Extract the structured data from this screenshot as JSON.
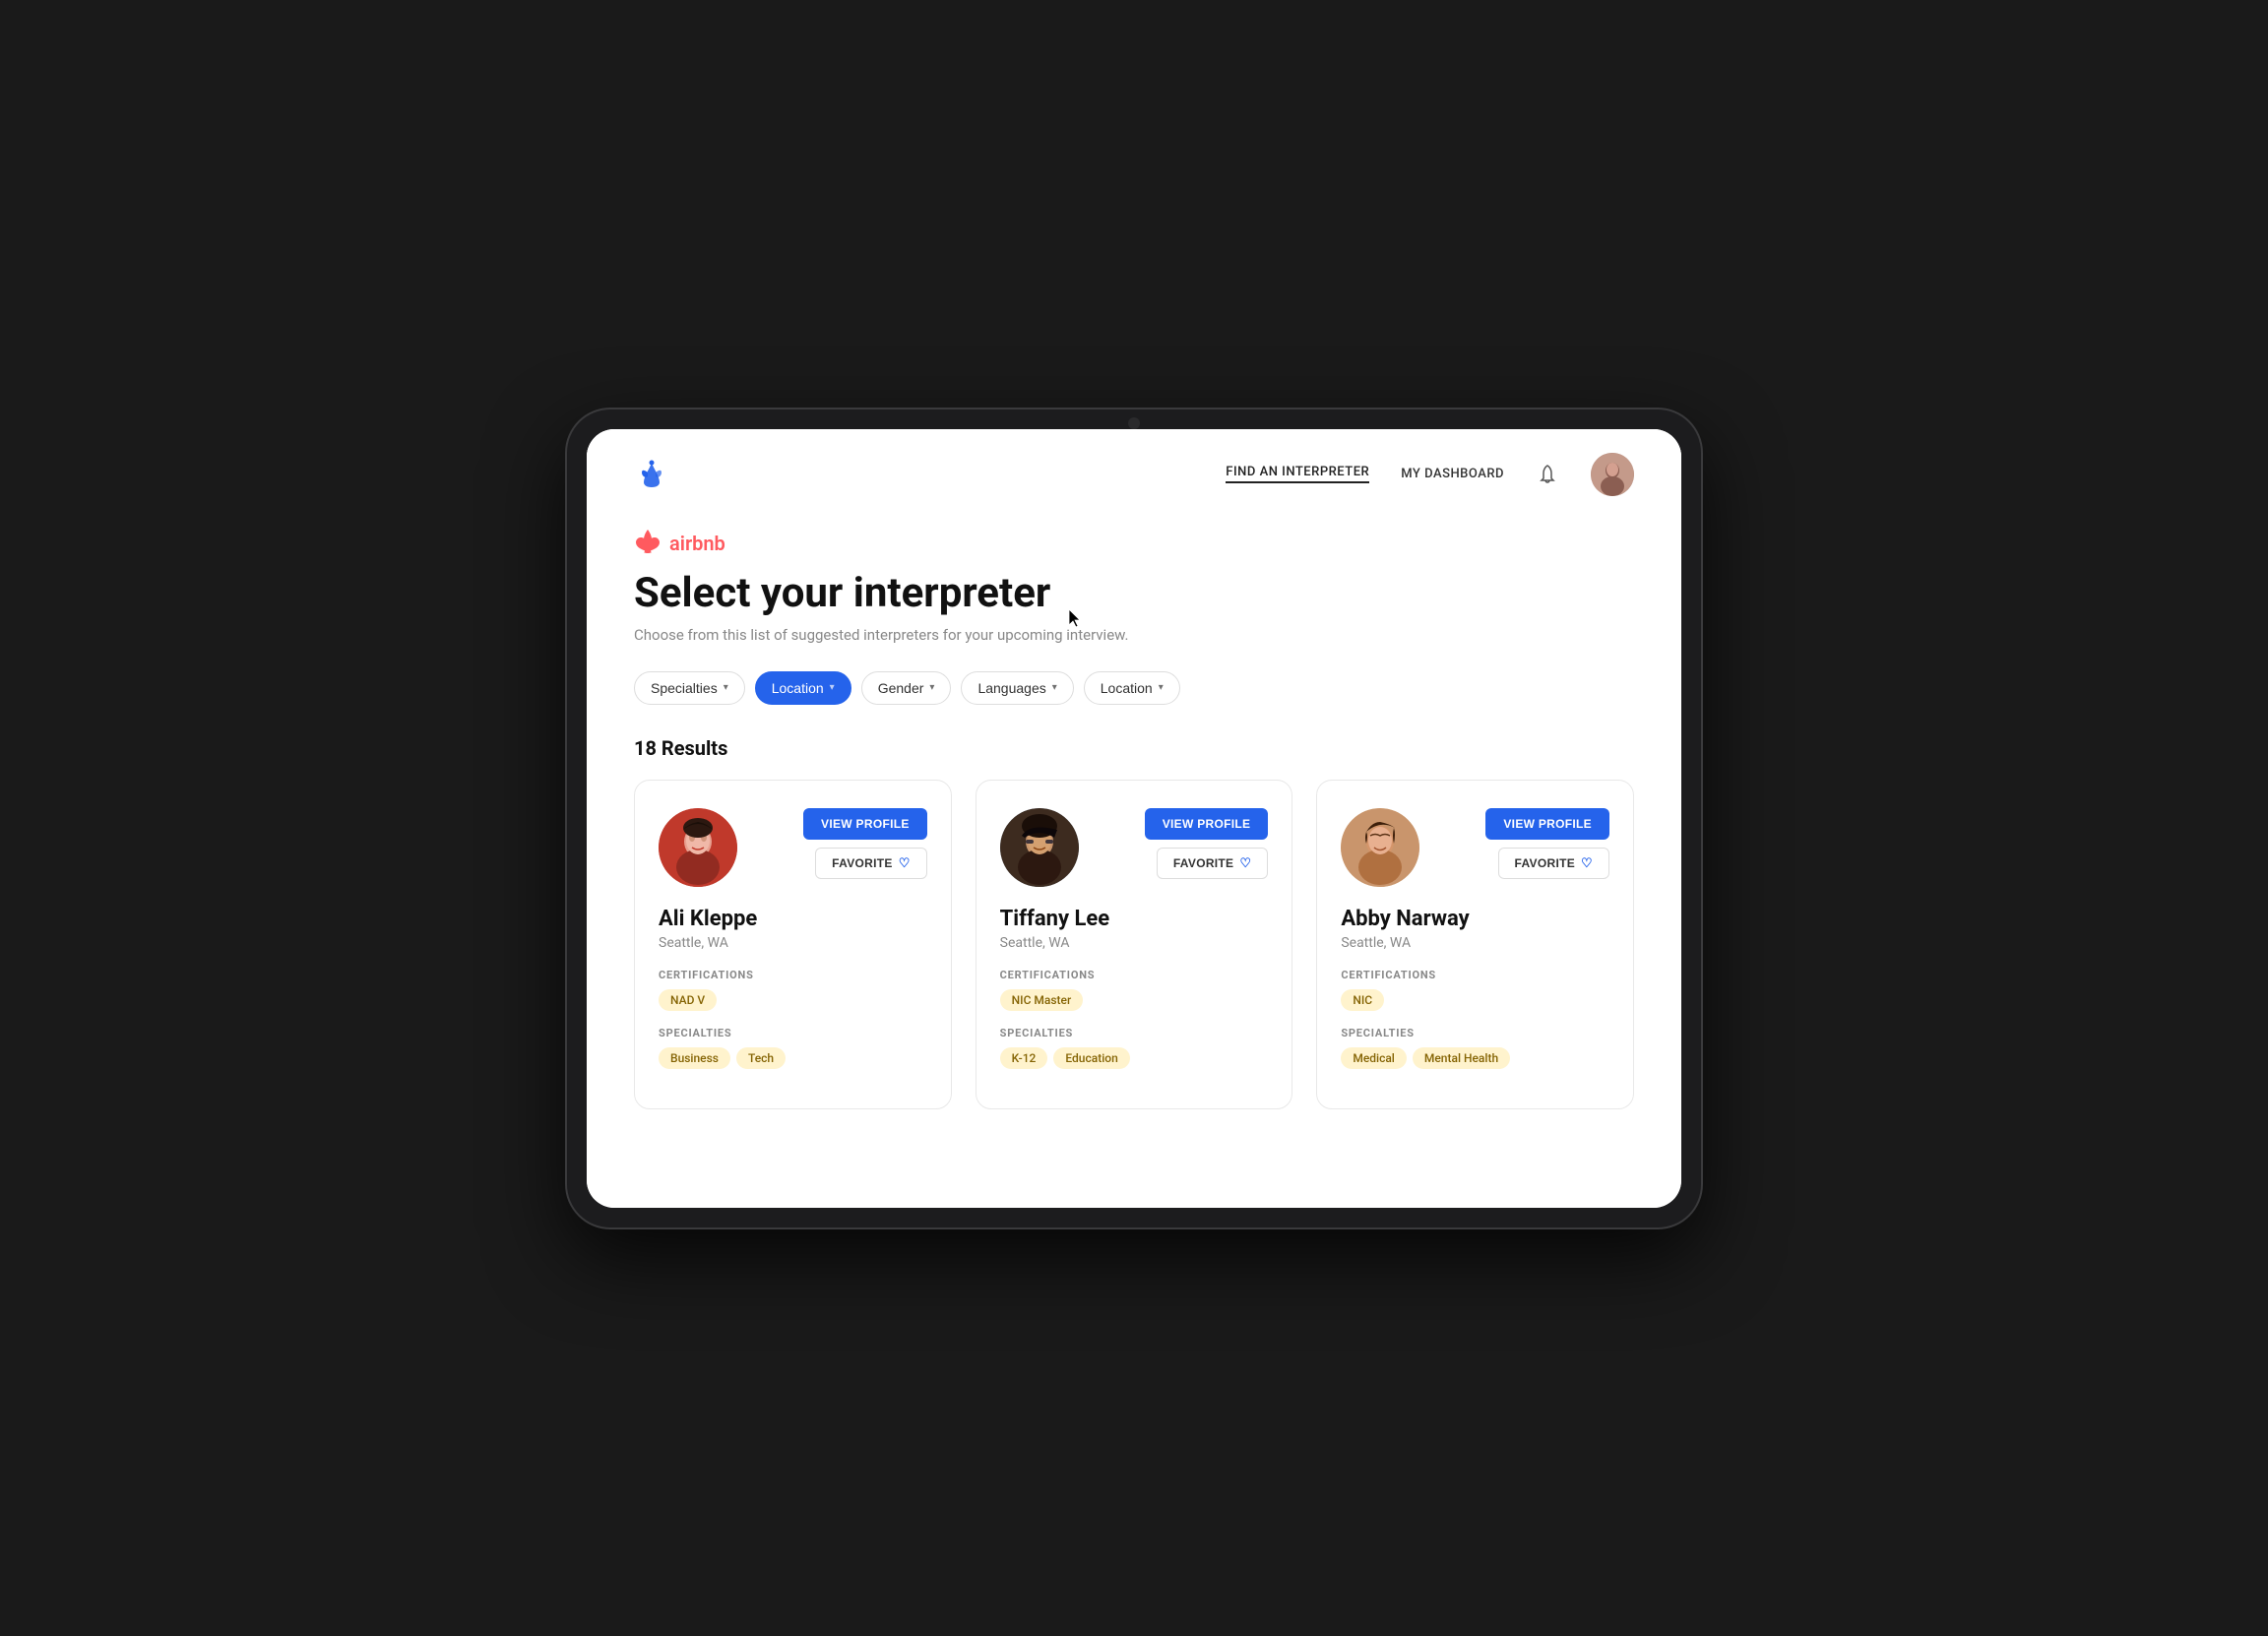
{
  "nav": {
    "logo_alt": "App Logo",
    "links": [
      {
        "label": "FIND AN INTERPRETER",
        "active": true
      },
      {
        "label": "MY DASHBOARD",
        "active": false
      }
    ]
  },
  "brand": {
    "name": "airbnb",
    "logo_alt": "Airbnb logo"
  },
  "header": {
    "title": "Select your interpreter",
    "subtitle": "Choose from this list of suggested interpreters for your upcoming interview."
  },
  "filters": [
    {
      "label": "Specialties",
      "active": false
    },
    {
      "label": "Location",
      "active": true
    },
    {
      "label": "Gender",
      "active": false
    },
    {
      "label": "Languages",
      "active": false
    },
    {
      "label": "Location",
      "active": false
    }
  ],
  "results": {
    "count": "18 Results"
  },
  "interpreters": [
    {
      "name": "Ali Kleppe",
      "location": "Seattle, WA",
      "certifications_label": "CERTIFICATIONS",
      "certifications": [
        "NAD V"
      ],
      "specialties_label": "SPECIALTIES",
      "specialties": [
        "Business",
        "Tech"
      ],
      "view_profile_label": "VIEW PROFILE",
      "favorite_label": "FAVORITE"
    },
    {
      "name": "Tiffany Lee",
      "location": "Seattle, WA",
      "certifications_label": "CERTIFICATIONS",
      "certifications": [
        "NIC Master"
      ],
      "specialties_label": "SPECIALTIES",
      "specialties": [
        "K-12",
        "Education"
      ],
      "view_profile_label": "VIEW PROFILE",
      "favorite_label": "FAVORITE"
    },
    {
      "name": "Abby Narway",
      "location": "Seattle, WA",
      "certifications_label": "CERTIFICATIONS",
      "certifications": [
        "NIC"
      ],
      "specialties_label": "SPECIALTIES",
      "specialties": [
        "Medical",
        "Mental Health"
      ],
      "view_profile_label": "VIEW PROFILE",
      "favorite_label": "FAVORITE"
    }
  ],
  "icons": {
    "chevron_down": "▾",
    "heart": "♡",
    "bell": "🔔"
  }
}
